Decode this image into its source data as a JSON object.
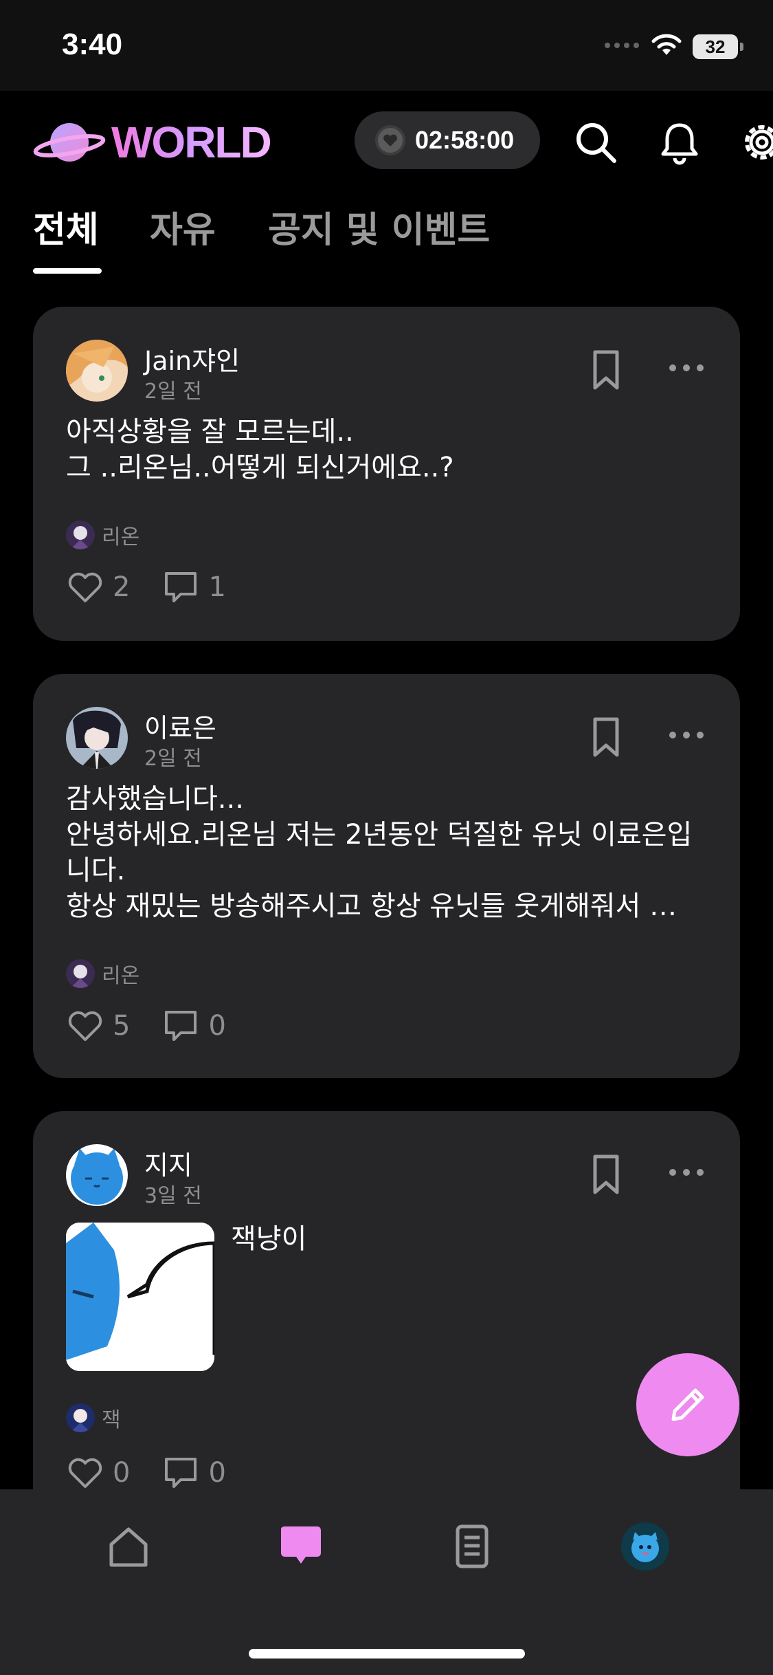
{
  "status_bar": {
    "time": "3:40",
    "battery": "32"
  },
  "header": {
    "logo_text": "WORLD",
    "timer": "02:58:00",
    "icons": [
      "search-icon",
      "bell-icon",
      "gear-icon"
    ]
  },
  "tabs": [
    {
      "label": "전체",
      "active": true
    },
    {
      "label": "자유",
      "active": false
    },
    {
      "label": "공지 및 이벤트",
      "active": false
    }
  ],
  "posts": [
    {
      "author": "Jain쟈인",
      "time": "2일 전",
      "body": "아직상황을 잘 모르는데..\n그 ..리온님..어떻게 되신거에요..?",
      "tag": "리온",
      "likes": "2",
      "comments": "1"
    },
    {
      "author": "이료은",
      "time": "2일 전",
      "body": "감사했습니다...\n안녕하세요.리온님 저는 2년동안 덕질한 유닛 이료은입니다.\n항상 재밌는 방송해주시고 항상 유닛들 웃게해줘서 …",
      "tag": "리온",
      "likes": "5",
      "comments": "0"
    },
    {
      "author": "지지",
      "time": "3일 전",
      "body": "잭냥이",
      "tag": "잭",
      "likes": "0",
      "comments": "0"
    }
  ],
  "colors": {
    "accent": "#ee8af0",
    "card": "#262628",
    "background": "#000000"
  },
  "bottom_nav": [
    "home-icon",
    "chat-icon",
    "document-icon",
    "profile-avatar"
  ]
}
